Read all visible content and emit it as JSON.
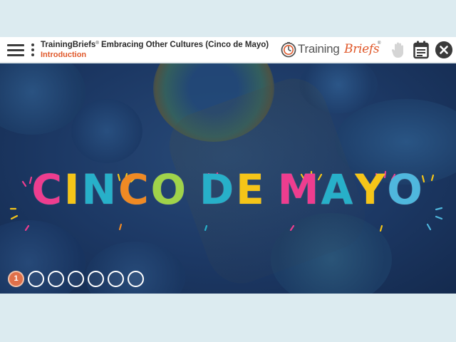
{
  "header": {
    "brand_prefix": "TrainingBriefs",
    "brand_reg": "®",
    "course_title": " Embracing Other Cultures (Cinco de Mayo)",
    "section": "Introduction"
  },
  "logo": {
    "training": "Training",
    "briefs": "Briefs",
    "reg": "®"
  },
  "slide": {
    "headline_letters": [
      "C",
      "I",
      "N",
      "C",
      "O",
      " ",
      "D",
      "E",
      " ",
      "M",
      "A",
      "Y",
      "O"
    ],
    "headline_colors": [
      "#ee3d8f",
      "#f5c518",
      "#27b0c9",
      "#f08a24",
      "#a0d34a",
      "",
      "#27b0c9",
      "#f5c518",
      "",
      "#ee3d8f",
      "#27b0c9",
      "#f5c518",
      "#4fb7dd"
    ]
  },
  "pager": {
    "pages": [
      "1",
      "",
      "",
      "",
      "",
      "",
      ""
    ],
    "active_index": 0
  },
  "colors": {
    "accent": "#e0582a",
    "stage": "#1c3864"
  },
  "icons": [
    "hamburger-icon",
    "kebab-icon",
    "clock-icon",
    "hand-icon",
    "calendar-icon",
    "close-icon"
  ]
}
